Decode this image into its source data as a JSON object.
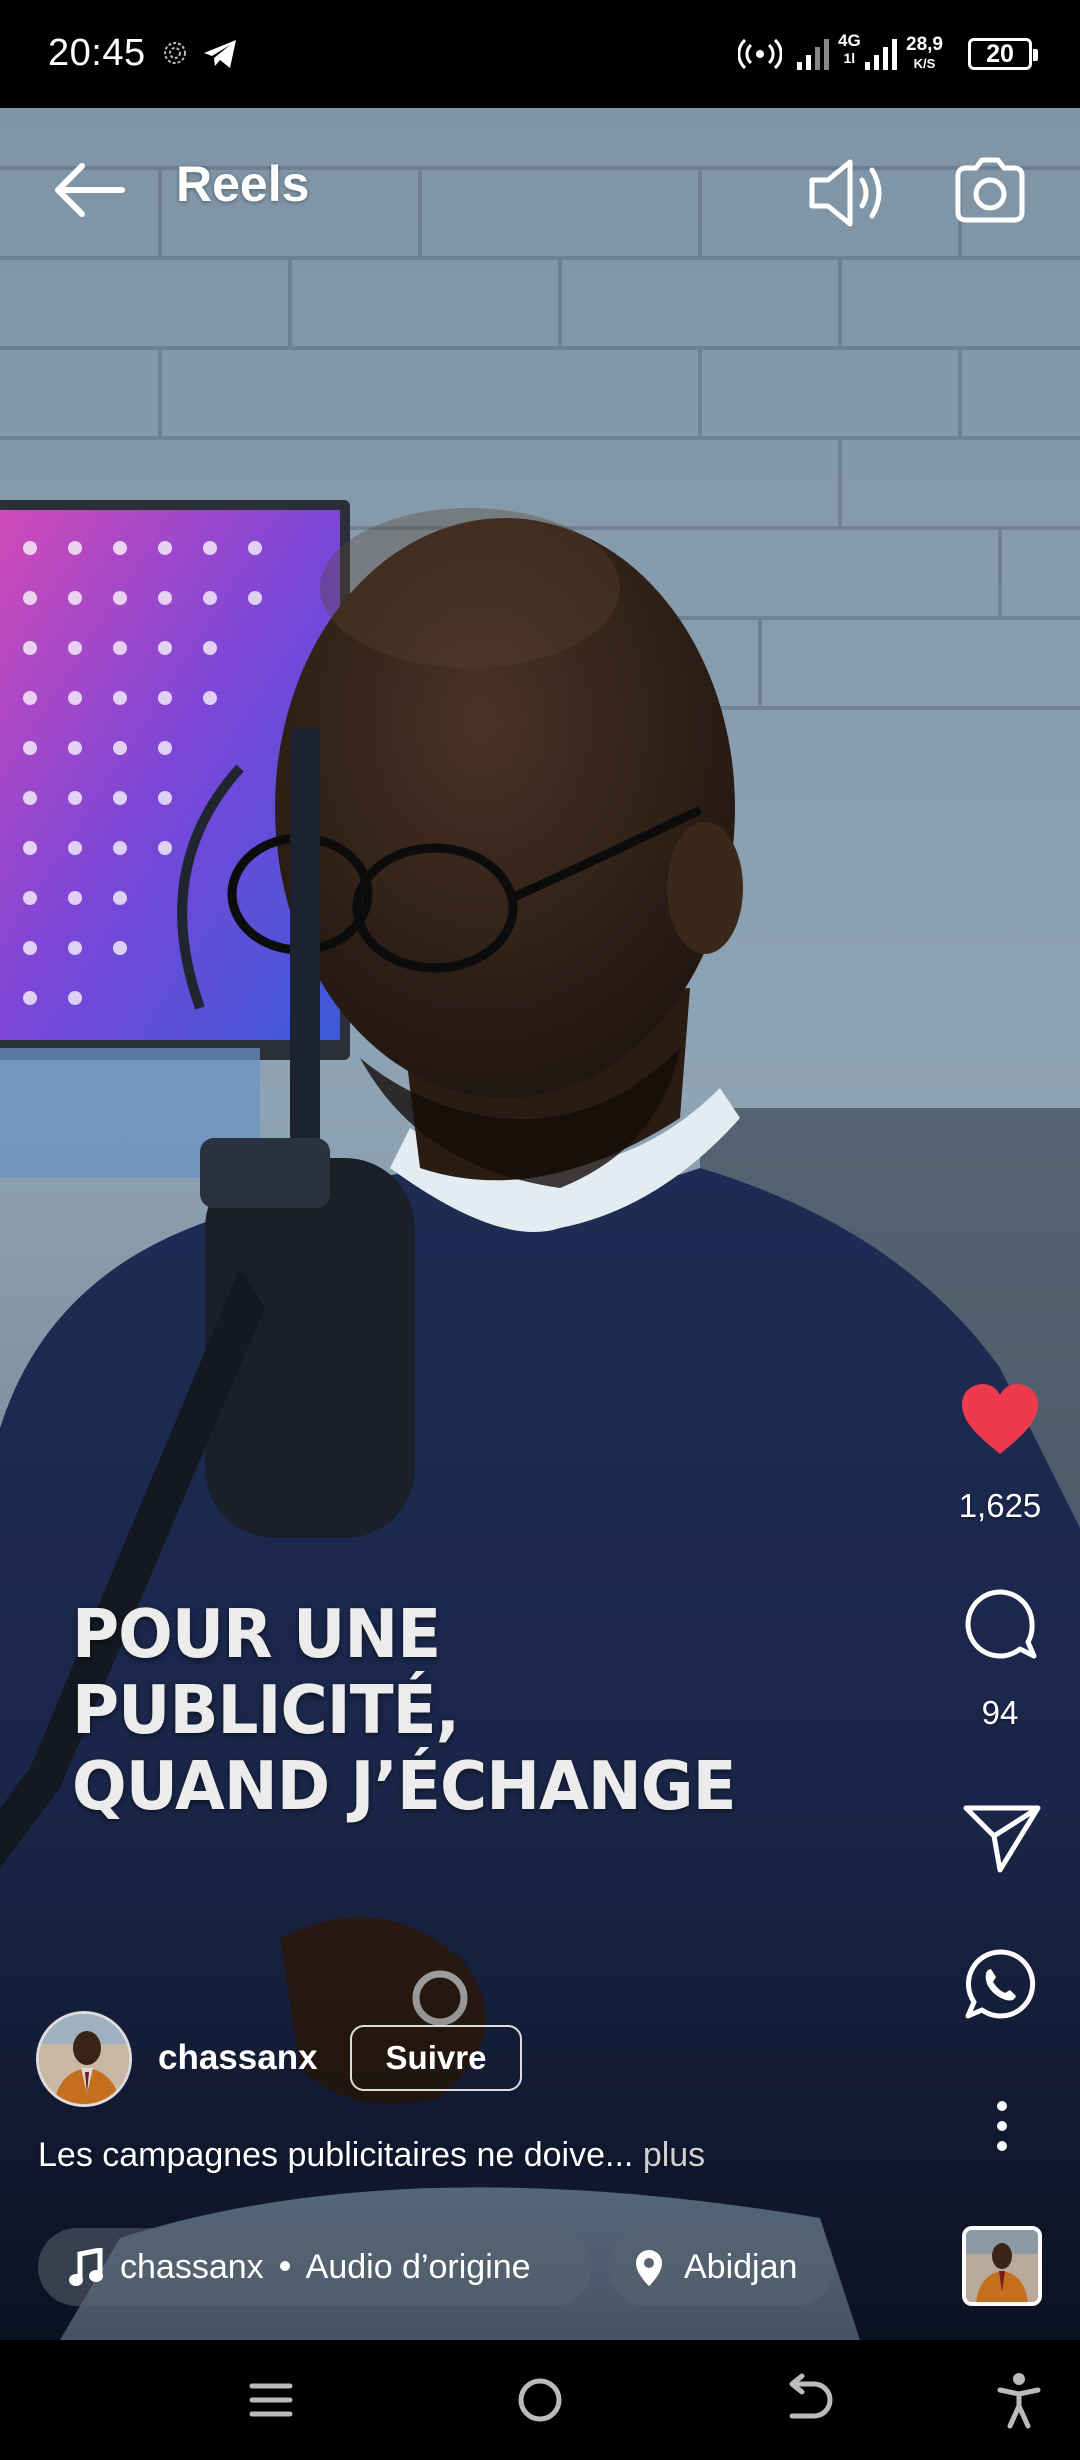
{
  "status_bar": {
    "time": "20:45",
    "network_type": "4G",
    "network_sub": "1l",
    "speed_value": "28,9",
    "speed_unit": "K/S",
    "battery": "20"
  },
  "top_bar": {
    "title": "Reels",
    "back_icon": "arrow-left-icon",
    "volume_icon": "volume-icon",
    "camera_icon": "camera-icon"
  },
  "video": {
    "caption_line1": "POUR UNE PUBLICITÉ,",
    "caption_line2": "QUAND J’ÉCHANGE"
  },
  "actions": {
    "likes": "1,625",
    "comments": "94",
    "like_color": "#ed3b4d"
  },
  "post": {
    "username": "chassanx",
    "follow_label": "Suivre",
    "description": "Les campagnes publicitaires ne doive...",
    "more_label": "plus",
    "audio_user": "chassanx",
    "audio_label": "Audio d’origine",
    "location": "Abidjan"
  },
  "nav_bar": {
    "recents_icon": "menu-lines-icon",
    "home_icon": "circle-home-icon",
    "back_icon": "return-arrow-icon",
    "accessibility_icon": "accessibility-icon"
  }
}
